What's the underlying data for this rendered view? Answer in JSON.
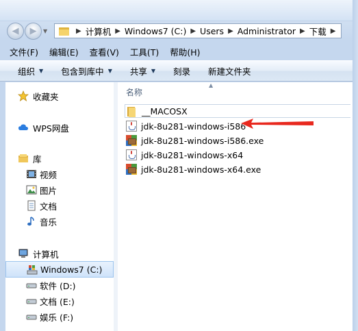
{
  "address": {
    "crumbs": [
      "计算机",
      "Windows7 (C:)",
      "Users",
      "Administrator",
      "下载"
    ]
  },
  "menu": [
    "文件(F)",
    "编辑(E)",
    "查看(V)",
    "工具(T)",
    "帮助(H)"
  ],
  "toolbar": [
    "组织",
    "包含到库中",
    "共享",
    "刻录",
    "新建文件夹"
  ],
  "nav": {
    "favorites": "收藏夹",
    "wps": "WPS网盘",
    "library": "库",
    "library_items": [
      "视频",
      "图片",
      "文档",
      "音乐"
    ],
    "computer": "计算机",
    "drives": [
      "Windows7 (C:)",
      "软件 (D:)",
      "文档 (E:)",
      "娱乐 (F:)"
    ],
    "selected_drive": "Windows7 (C:)"
  },
  "content": {
    "column_name": "名称",
    "files": [
      {
        "name": "__MACOSX",
        "icon": "folder-icon"
      },
      {
        "name": "jdk-8u281-windows-i586",
        "icon": "java-file-icon"
      },
      {
        "name": "jdk-8u281-windows-i586.exe",
        "icon": "installer-icon"
      },
      {
        "name": "jdk-8u281-windows-x64",
        "icon": "java-file-icon"
      },
      {
        "name": "jdk-8u281-windows-x64.exe",
        "icon": "installer-icon"
      }
    ]
  },
  "colors": {
    "annotation_arrow": "#e8281e",
    "selection_border": "#9cc4ee"
  }
}
